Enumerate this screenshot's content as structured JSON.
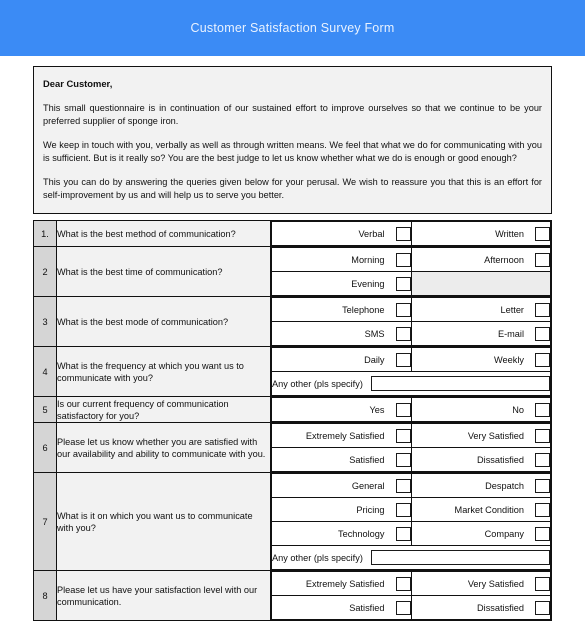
{
  "banner": {
    "title": "Customer Satisfaction Survey Form"
  },
  "intro": {
    "salutation": "Dear Customer,",
    "paragraph1": "This small questionnaire is in continuation of our sustained effort to improve ourselves so that we continue to be your preferred supplier of sponge iron.",
    "paragraph2": "We keep in touch with you, verbally as well as through written means. We feel that what we do for communicating with you is sufficient. But is it really so? You are the best judge to let us know whether what we do is enough or good enough?",
    "paragraph3": "This you can do by answering the queries given below for your perusal. We wish to reassure you that this is an effort for self-improvement by us and will help us to serve you better."
  },
  "table": {
    "rows": [
      {
        "number": "1.",
        "question": "What is the best method of communication?",
        "lines": [
          {
            "type": "options",
            "left": "Verbal",
            "right": "Written"
          }
        ]
      },
      {
        "number": "2",
        "question": "What is the best time of communication?",
        "lines": [
          {
            "type": "options",
            "left": "Morning",
            "right": "Afternoon"
          },
          {
            "type": "options",
            "left": "Evening",
            "right": ""
          }
        ]
      },
      {
        "number": "3",
        "question": "What is the best mode of communication?",
        "lines": [
          {
            "type": "options",
            "left": "Telephone",
            "right": "Letter"
          },
          {
            "type": "options",
            "left": "SMS",
            "right": "E-mail"
          }
        ]
      },
      {
        "number": "4",
        "question": "What is the frequency at which you want us to communicate with you?",
        "lines": [
          {
            "type": "options",
            "left": "Daily",
            "right": "Weekly"
          },
          {
            "type": "other",
            "label": "Any other (pls specify)",
            "value": ""
          }
        ]
      },
      {
        "number": "5",
        "question": "Is our current frequency of communication satisfactory for you?",
        "lines": [
          {
            "type": "options",
            "left": "Yes",
            "right": "No"
          }
        ]
      },
      {
        "number": "6",
        "question": "Please let us know whether you are satisfied with our availability and ability to communicate with you.",
        "lines": [
          {
            "type": "options",
            "left": "Extremely Satisfied",
            "right": "Very Satisfied"
          },
          {
            "type": "options",
            "left": "Satisfied",
            "right": "Dissatisfied"
          }
        ]
      },
      {
        "number": "7",
        "question": "What is it on which you want us to communicate with you?",
        "lines": [
          {
            "type": "options",
            "left": "General",
            "right": "Despatch"
          },
          {
            "type": "options",
            "left": "Pricing",
            "right": "Market Condition"
          },
          {
            "type": "options",
            "left": "Technology",
            "right": "Company"
          },
          {
            "type": "other",
            "label": "Any other (pls specify)",
            "value": ""
          }
        ]
      },
      {
        "number": "8",
        "question": "Please let us have your satisfaction level with our communication.",
        "lines": [
          {
            "type": "options",
            "left": "Extremely Satisfied",
            "right": "Very Satisfied"
          },
          {
            "type": "options",
            "left": "Satisfied",
            "right": "Dissatisfied"
          }
        ]
      }
    ]
  },
  "colors": {
    "banner": "#3b8bf5",
    "banner_text": "#e9f2ff",
    "number_cell": "#d5d5d5",
    "question_cell": "#f2f2f2",
    "blank_cell": "#ececec",
    "border": "#111111"
  }
}
